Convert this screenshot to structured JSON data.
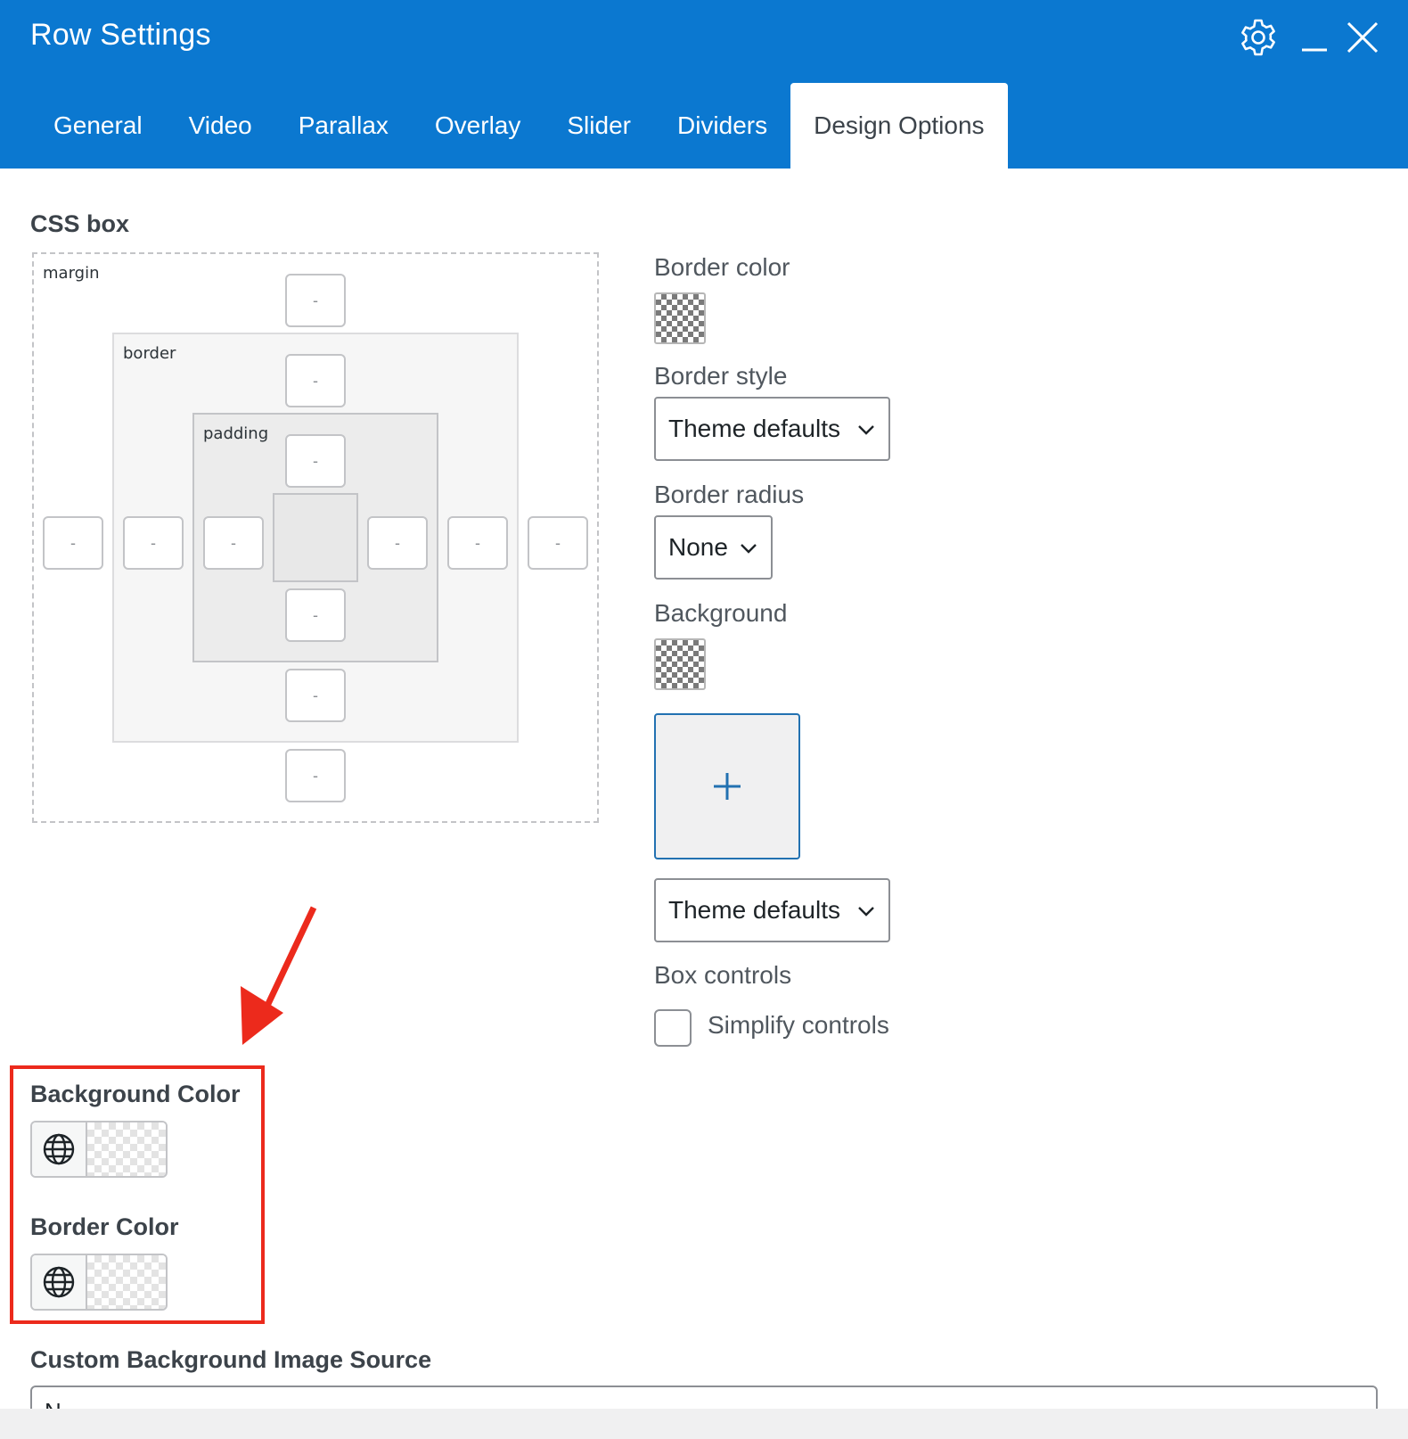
{
  "window": {
    "title": "Row Settings",
    "icons": {
      "settings": "gear-icon",
      "minimize": "minimize-icon",
      "close": "close-icon"
    }
  },
  "tabs": [
    {
      "label": "General",
      "active": false
    },
    {
      "label": "Video",
      "active": false
    },
    {
      "label": "Parallax",
      "active": false
    },
    {
      "label": "Overlay",
      "active": false
    },
    {
      "label": "Slider",
      "active": false
    },
    {
      "label": "Dividers",
      "active": false
    },
    {
      "label": "Design Options",
      "active": true
    }
  ],
  "css_box": {
    "title": "CSS box",
    "margin_label": "margin",
    "border_label": "border",
    "padding_label": "padding",
    "margin": {
      "top": "-",
      "right": "-",
      "bottom": "-",
      "left": "-"
    },
    "border": {
      "top": "-",
      "right": "-",
      "bottom": "-",
      "left": "-"
    },
    "padding": {
      "top": "-",
      "right": "-",
      "bottom": "-",
      "left": "-"
    }
  },
  "design": {
    "border_color_label": "Border color",
    "border_style_label": "Border style",
    "border_style_value": "Theme defaults",
    "border_radius_label": "Border radius",
    "border_radius_value": "None",
    "background_label": "Background",
    "background_image_icon": "plus-icon",
    "background_style_value": "Theme defaults",
    "box_controls_label": "Box controls",
    "simplify_controls_label": "Simplify controls",
    "simplify_controls_checked": false
  },
  "extra_colors": {
    "background_color_label": "Background Color",
    "border_color_label": "Border Color",
    "globe_icon": "globe-icon"
  },
  "custom_bg": {
    "label": "Custom Background Image Source",
    "value": "N"
  },
  "colors": {
    "header": "#0b78d0",
    "highlight": "#ec2a1c",
    "accent": "#2271b1"
  }
}
